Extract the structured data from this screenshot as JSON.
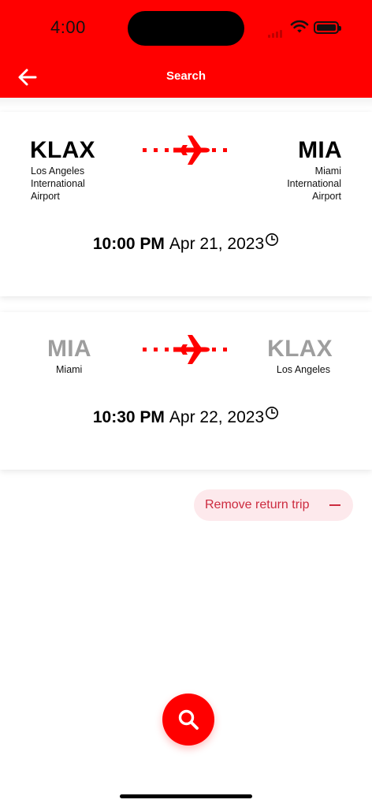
{
  "status_bar": {
    "time": "4:00"
  },
  "header": {
    "title": "Search"
  },
  "outbound": {
    "origin": {
      "code": "KLAX",
      "name_lines": [
        "Los Angeles",
        "International",
        "Airport"
      ]
    },
    "destination": {
      "code": "MIA",
      "name_lines": [
        "Miami",
        "International",
        "Airport"
      ]
    },
    "time": "10:00 PM",
    "date": "Apr 21, 2023"
  },
  "return": {
    "origin": {
      "code": "MIA",
      "name": "Miami"
    },
    "destination": {
      "code": "KLAX",
      "name": "Los Angeles"
    },
    "time": "10:30 PM",
    "date": "Apr 22, 2023"
  },
  "actions": {
    "remove_return_label": "Remove return trip"
  },
  "icons": {
    "back": "arrow-left-icon",
    "plane": "airplane-icon",
    "clock": "clock-icon",
    "minus": "minus-icon",
    "search": "search-icon"
  },
  "colors": {
    "brand_red": "#ff0000",
    "muted_code": "#9e9e9e",
    "pill_bg": "#fde9ec",
    "pill_text": "#cc2b3f"
  }
}
